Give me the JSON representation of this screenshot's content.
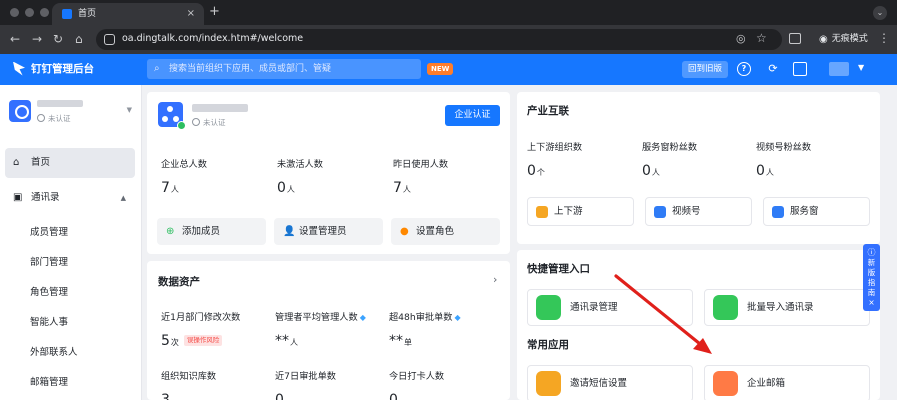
{
  "browser": {
    "tab_title": "首页",
    "tab_close": "×",
    "new_tab": "+",
    "url": "oa.dingtalk.com/index.htm#/welcome",
    "incognito_label": "无痕模式"
  },
  "header": {
    "app_title": "钉钉管理后台",
    "search_placeholder": "搜索当前组织下应用、成员或部门、管疑",
    "new_badge": "NEW",
    "old_version": "回到旧版"
  },
  "sidebar": {
    "org_status": "未认证",
    "items": [
      {
        "label": "首页",
        "icon": "home-icon"
      },
      {
        "label": "通讯录",
        "icon": "contacts-icon"
      }
    ],
    "sub_items": [
      "成员管理",
      "部门管理",
      "角色管理",
      "智能人事",
      "外部联系人",
      "邮箱管理"
    ]
  },
  "org_card": {
    "status": "未认证",
    "verify_button": "企业认证",
    "stats": [
      {
        "label": "企业总人数",
        "value": "7",
        "unit": "人"
      },
      {
        "label": "未激活人数",
        "value": "0",
        "unit": "人"
      },
      {
        "label": "昨日使用人数",
        "value": "7",
        "unit": "人"
      }
    ],
    "actions": [
      {
        "label": "添加成员",
        "icon": "add-member-icon"
      },
      {
        "label": "设置管理员",
        "icon": "admin-icon"
      },
      {
        "label": "设置角色",
        "icon": "role-icon"
      }
    ]
  },
  "assets": {
    "title": "数据资产",
    "stats": [
      {
        "label": "近1月部门修改次数",
        "value": "5",
        "unit": "次",
        "tag": "误操作风险"
      },
      {
        "label": "管理者平均管理人数",
        "value": "**",
        "unit": "人"
      },
      {
        "label": "超48h审批单数",
        "value": "**",
        "unit": "单"
      },
      {
        "label": "组织知识库数",
        "value": "3",
        "unit": ""
      },
      {
        "label": "近7日审批单数",
        "value": "0",
        "unit": ""
      },
      {
        "label": "今日打卡人数",
        "value": "0",
        "unit": ""
      }
    ]
  },
  "industry": {
    "title": "产业互联",
    "stats": [
      {
        "label": "上下游组织数",
        "value": "0",
        "unit": "个"
      },
      {
        "label": "服务窗粉丝数",
        "value": "0",
        "unit": "人"
      },
      {
        "label": "视频号粉丝数",
        "value": "0",
        "unit": "人"
      }
    ],
    "buttons": [
      {
        "label": "上下游",
        "color": "#f5a623"
      },
      {
        "label": "视频号",
        "color": "#2f7cf6"
      },
      {
        "label": "服务窗",
        "color": "#2f7cf6"
      }
    ]
  },
  "shortcuts": {
    "title": "快捷管理入口",
    "items": [
      {
        "label": "通讯录管理",
        "color": "#34c759"
      },
      {
        "label": "批量导入通讯录",
        "color": "#34c759"
      }
    ],
    "apps_title": "常用应用",
    "apps": [
      {
        "label": "邀请短信设置",
        "color": "#f5a623"
      },
      {
        "label": "企业邮箱",
        "color": "#ff7a45"
      }
    ]
  },
  "guide": {
    "lines": [
      "新",
      "版",
      "指",
      "南"
    ],
    "close": "×"
  },
  "colors": {
    "brand": "#1677ff",
    "annotation_arrow": "#e0201b"
  }
}
